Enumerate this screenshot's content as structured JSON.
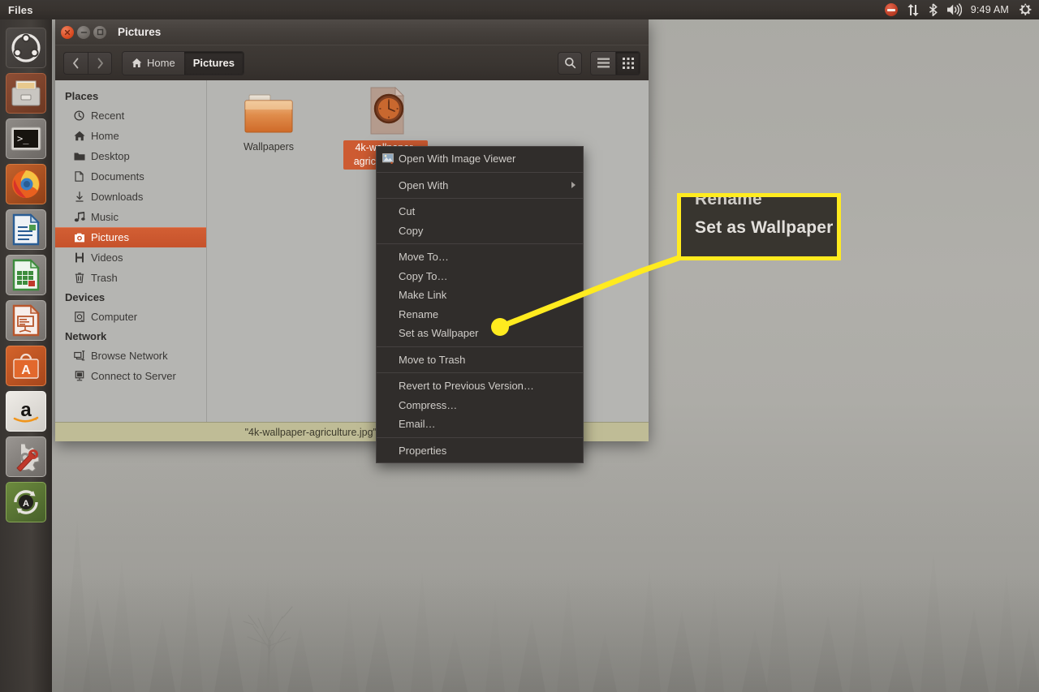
{
  "top_panel": {
    "app_name": "Files",
    "clock": "9:49 AM",
    "indicators": [
      {
        "name": "messaging-indicator",
        "glyph": "messages"
      },
      {
        "name": "network-indicator",
        "glyph": "up-down-arrows"
      },
      {
        "name": "bluetooth-indicator",
        "glyph": "bluetooth"
      },
      {
        "name": "volume-indicator",
        "glyph": "speaker"
      },
      {
        "name": "system-menu-indicator",
        "glyph": "gear-power"
      }
    ]
  },
  "launcher": {
    "items": [
      {
        "name": "ubuntu-dash",
        "label": "Ubuntu Dash",
        "running": false
      },
      {
        "name": "files-nautilus",
        "label": "Files",
        "running": true
      },
      {
        "name": "terminal",
        "label": "Terminal",
        "running": false
      },
      {
        "name": "firefox",
        "label": "Firefox Web Browser",
        "running": false
      },
      {
        "name": "libreoffice-writer",
        "label": "LibreOffice Writer",
        "running": false
      },
      {
        "name": "libreoffice-calc",
        "label": "LibreOffice Calc",
        "running": false
      },
      {
        "name": "libreoffice-impress",
        "label": "LibreOffice Impress",
        "running": false
      },
      {
        "name": "ubuntu-software",
        "label": "Ubuntu Software",
        "running": false
      },
      {
        "name": "amazon",
        "label": "Amazon",
        "running": false
      },
      {
        "name": "system-settings",
        "label": "System Settings",
        "running": false
      },
      {
        "name": "software-updater",
        "label": "Software Updater",
        "running": true
      }
    ]
  },
  "window": {
    "title": "Pictures",
    "controls": {
      "close": "Close",
      "minimize": "Minimize",
      "maximize": "Maximize"
    },
    "toolbar": {
      "back_label": "Back",
      "forward_label": "Forward",
      "search_label": "Search",
      "list_view_label": "List view",
      "grid_view_label": "Grid view",
      "breadcrumbs": [
        {
          "label": "Home",
          "icon": "home-icon",
          "active": false
        },
        {
          "label": "Pictures",
          "icon": "",
          "active": true
        }
      ]
    },
    "sidebar": {
      "groups": [
        {
          "heading": "Places",
          "items": [
            {
              "label": "Recent",
              "icon": "clock-icon",
              "selected": false
            },
            {
              "label": "Home",
              "icon": "home-icon",
              "selected": false
            },
            {
              "label": "Desktop",
              "icon": "folder-icon",
              "selected": false
            },
            {
              "label": "Documents",
              "icon": "document-icon",
              "selected": false
            },
            {
              "label": "Downloads",
              "icon": "download-icon",
              "selected": false
            },
            {
              "label": "Music",
              "icon": "music-note-icon",
              "selected": false
            },
            {
              "label": "Pictures",
              "icon": "camera-icon",
              "selected": true
            },
            {
              "label": "Videos",
              "icon": "film-icon",
              "selected": false
            },
            {
              "label": "Trash",
              "icon": "trash-icon",
              "selected": false
            }
          ]
        },
        {
          "heading": "Devices",
          "items": [
            {
              "label": "Computer",
              "icon": "computer-icon",
              "selected": false
            }
          ]
        },
        {
          "heading": "Network",
          "items": [
            {
              "label": "Browse Network",
              "icon": "network-icon",
              "selected": false
            },
            {
              "label": "Connect to Server",
              "icon": "server-icon",
              "selected": false
            }
          ]
        }
      ]
    },
    "files": [
      {
        "name": "Wallpapers",
        "type": "folder",
        "selected": false
      },
      {
        "name": "4k-wallpaper-agriculture.jpg",
        "type": "image",
        "selected": true
      }
    ],
    "statusbar": "\"4k-wallpaper-agriculture.jpg\" selected (2.6 MB)"
  },
  "context_menu": {
    "items": [
      {
        "label": "Open With Image Viewer",
        "icon": "image-viewer-icon",
        "submenu": false,
        "separator_after": true
      },
      {
        "label": "Open With",
        "icon": "",
        "submenu": true,
        "separator_after": true
      },
      {
        "label": "Cut",
        "icon": "",
        "submenu": false,
        "separator_after": false
      },
      {
        "label": "Copy",
        "icon": "",
        "submenu": false,
        "separator_after": true
      },
      {
        "label": "Move To…",
        "icon": "",
        "submenu": false,
        "separator_after": false
      },
      {
        "label": "Copy To…",
        "icon": "",
        "submenu": false,
        "separator_after": false
      },
      {
        "label": "Make Link",
        "icon": "",
        "submenu": false,
        "separator_after": false
      },
      {
        "label": "Rename",
        "icon": "",
        "submenu": false,
        "separator_after": false
      },
      {
        "label": "Set as Wallpaper",
        "icon": "",
        "submenu": false,
        "separator_after": true
      },
      {
        "label": "Move to Trash",
        "icon": "",
        "submenu": false,
        "separator_after": true
      },
      {
        "label": "Revert to Previous Version…",
        "icon": "",
        "submenu": false,
        "separator_after": false
      },
      {
        "label": "Compress…",
        "icon": "",
        "submenu": false,
        "separator_after": false
      },
      {
        "label": "Email…",
        "icon": "",
        "submenu": false,
        "separator_after": true
      },
      {
        "label": "Properties",
        "icon": "",
        "submenu": false,
        "separator_after": false
      }
    ]
  },
  "annotation": {
    "highlight_color": "#ffeb1f",
    "callout_line_1": "Rename",
    "callout_line_2": "Set as Wallpaper",
    "target_item": "Set as Wallpaper"
  }
}
